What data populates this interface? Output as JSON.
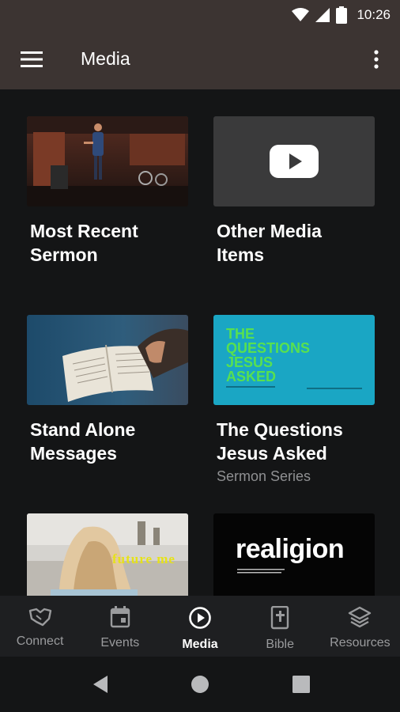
{
  "status_bar": {
    "time": "10:26",
    "icons": [
      "wifi-icon",
      "signal-icon",
      "battery-icon"
    ]
  },
  "app_bar": {
    "title": "Media",
    "menu_icon": "hamburger-menu-icon",
    "more_icon": "more-vert-icon"
  },
  "cards": [
    {
      "title_line1": "Most Recent",
      "title_line2": "Sermon",
      "subtitle": ""
    },
    {
      "title_line1": "Other Media",
      "title_line2": "Items",
      "subtitle": ""
    },
    {
      "title_line1": "Stand Alone",
      "title_line2": "Messages",
      "subtitle": ""
    },
    {
      "title_line1": "The Questions",
      "title_line2": "Jesus Asked",
      "subtitle": "Sermon Series",
      "thumb_text": [
        "THE",
        "QUESTIONS",
        "JESUS",
        "ASKED"
      ]
    },
    {
      "title_line1": "",
      "title_line2": "",
      "subtitle": "",
      "thumb_text": "future me"
    },
    {
      "title_line1": "",
      "title_line2": "",
      "subtitle": "",
      "thumb_text": "realigion"
    }
  ],
  "bottom_nav": {
    "items": [
      {
        "label": "Connect",
        "icon": "handshake-icon"
      },
      {
        "label": "Events",
        "icon": "calendar-icon"
      },
      {
        "label": "Media",
        "icon": "play-circle-icon"
      },
      {
        "label": "Bible",
        "icon": "bible-icon"
      },
      {
        "label": "Resources",
        "icon": "layers-icon"
      }
    ],
    "active": "Media"
  },
  "system_nav": {
    "icons": [
      "back-icon",
      "home-icon",
      "recents-icon"
    ]
  },
  "colors": {
    "app_bar": "#3c3432",
    "background": "#141516",
    "nav_bg": "#1e1f21",
    "questions_teal": "#1aa6c4",
    "questions_green": "#58e050"
  }
}
